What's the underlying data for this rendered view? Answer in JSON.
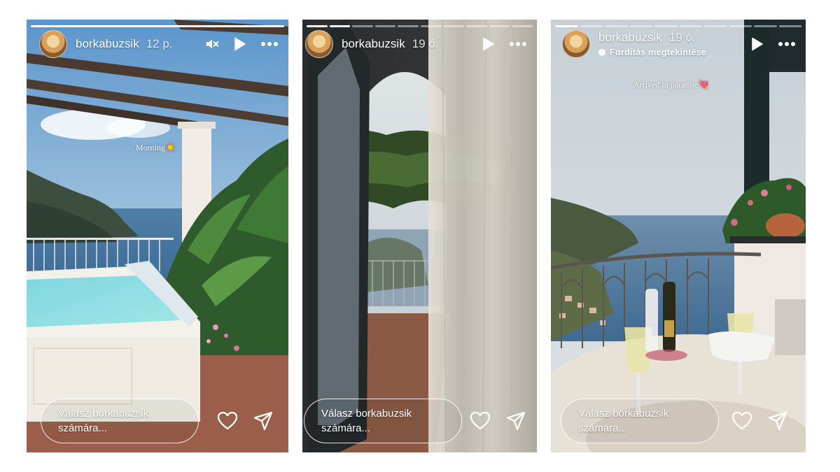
{
  "stories": [
    {
      "username": "borkabuzsik",
      "time": "12 p.",
      "caption": "Morning☀️",
      "reply_placeholder_line1": "Válasz borkabuzsik",
      "reply_placeholder_line2": "számára...",
      "icons": [
        "mute-icon",
        "play-icon",
        "more-options-icon",
        "heart-icon",
        "send-icon"
      ],
      "progress_segments": 1,
      "progress_watched": 1
    },
    {
      "username": "borkabuzsik",
      "time": "19 ó.",
      "reply_placeholder_line1": "Válasz borkabuzsik",
      "reply_placeholder_line2": "számára...",
      "icons": [
        "play-icon",
        "more-options-icon",
        "heart-icon",
        "send-icon"
      ],
      "progress_segments": 10,
      "progress_watched": 2
    },
    {
      "username": "borkabuzsik",
      "time": "19 ó.",
      "translation_link": "Fordítás megtekintése",
      "caption": "Arrived in paradise💘",
      "reply_placeholder_line1": "Válasz borkabuzsik",
      "reply_placeholder_line2": "számára...",
      "icons": [
        "play-icon",
        "more-options-icon",
        "heart-icon",
        "send-icon"
      ],
      "progress_segments": 10,
      "progress_watched": 1
    }
  ]
}
